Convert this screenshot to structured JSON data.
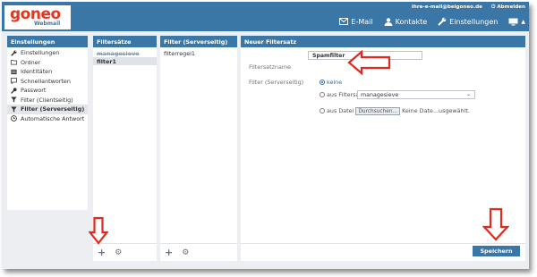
{
  "header": {
    "logo_word": "goneo",
    "logo_sub": "Webmail",
    "email": "ihre-e-mail@beigoneo.de",
    "logout": "Abmelden",
    "nav": [
      {
        "label": "E-Mail",
        "icon": "envelope-icon"
      },
      {
        "label": "Kontakte",
        "icon": "contacts-icon"
      },
      {
        "label": "Einstellungen",
        "icon": "wrench-icon"
      }
    ],
    "colors": {
      "bar": "#3b77a6",
      "logo": "#e3381f"
    }
  },
  "settings": {
    "title": "Einstellungen",
    "items": [
      {
        "label": "Einstellungen",
        "icon": "wrench-icon"
      },
      {
        "label": "Ordner",
        "icon": "folder-icon"
      },
      {
        "label": "Identitäten",
        "icon": "id-card-icon"
      },
      {
        "label": "Schnellantworten",
        "icon": "comment-icon"
      },
      {
        "label": "Passwort",
        "icon": "key-icon"
      },
      {
        "label": "Filter (Clientseitig)",
        "icon": "filter-icon"
      },
      {
        "label": "Filter (Serverseitig)",
        "icon": "filter-icon",
        "active": true
      },
      {
        "label": "Automatische Antwort",
        "icon": "clock-icon"
      }
    ]
  },
  "filtersets": {
    "title": "Filtersätze",
    "items": [
      {
        "label": "managesieve",
        "state": "disabled"
      },
      {
        "label": "filter1",
        "state": "selected"
      }
    ],
    "footer": [
      "add-icon",
      "gear-icon"
    ]
  },
  "filters": {
    "title": "Filter (Serverseitig)",
    "items": [
      {
        "label": "filterregel1"
      }
    ],
    "footer": [
      "add-icon",
      "gear-icon"
    ]
  },
  "form": {
    "title": "Neuer Filtersatz",
    "name_label": "Filtersatzname",
    "name_value": "Spamfilter",
    "filter_label": "Filter (Serverseitig)",
    "opt_none": "keine",
    "opt_from_set": "aus Filtersatz",
    "set_value": "managesieve",
    "opt_from_file": "aus Datei",
    "browse": "Durchsuchen...",
    "no_file": "Keine Date...usgewählt.",
    "save": "Speichern"
  }
}
